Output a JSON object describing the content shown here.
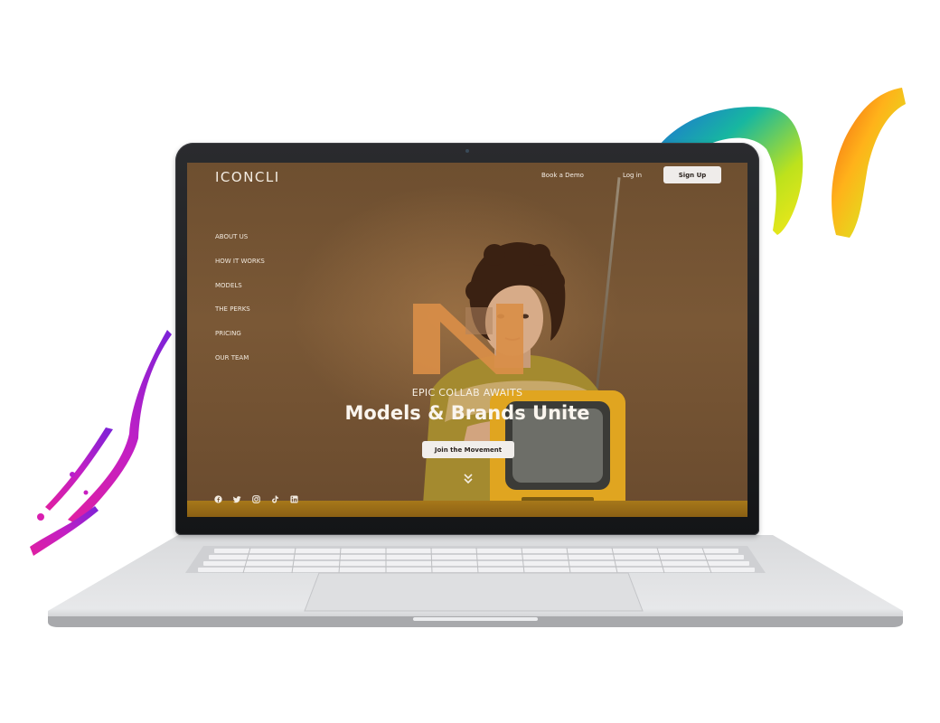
{
  "site": {
    "brand": "ICONCLI",
    "header": {
      "book_demo": "Book a Demo",
      "login": "Log in",
      "signup": "Sign Up"
    },
    "side_nav": [
      "ABOUT US",
      "HOW IT WORKS",
      "MODELS",
      "THE PERKS",
      "PRICING",
      "OUR TEAM"
    ],
    "hero": {
      "eyebrow": "EPIC COLLAB AWAITS",
      "headline": "Models & Brands Unite",
      "cta": "Join the Movement"
    },
    "social_icons": [
      "facebook-icon",
      "twitter-icon",
      "instagram-icon",
      "tiktok-icon",
      "linkedin-icon"
    ]
  },
  "colors": {
    "hero_bg": "#7a5836",
    "logo_mark": "#d98e48",
    "button_bg": "#efecea",
    "rainbow_paint": [
      "#2e7bd6",
      "#18b6a4",
      "#c9e21a",
      "#ffcf1a",
      "#f05a12"
    ],
    "purple_paint": [
      "#8a1fd6",
      "#d61fb1"
    ]
  }
}
